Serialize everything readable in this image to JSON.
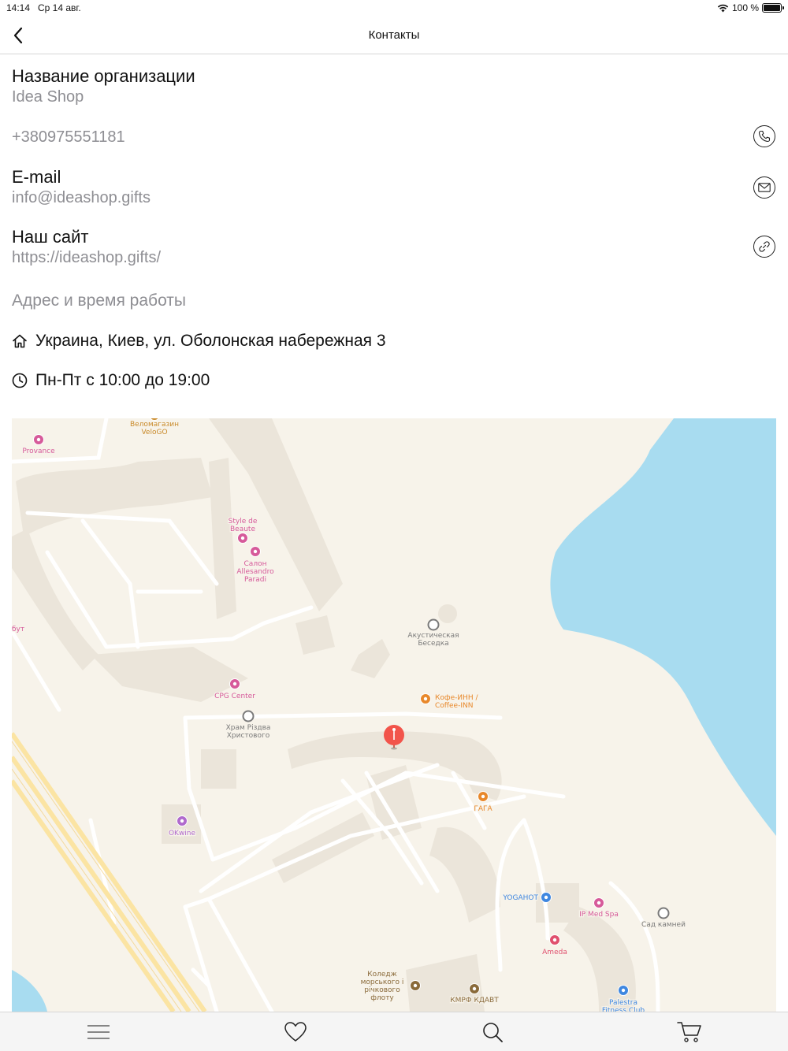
{
  "status_bar": {
    "time": "14:14",
    "date": "Ср 14 авг.",
    "battery": "100 %"
  },
  "nav": {
    "title": "Контакты"
  },
  "org": {
    "label": "Название организации",
    "value": "Idea Shop"
  },
  "phone": {
    "value": "+380975551181"
  },
  "email": {
    "label": "E-mail",
    "value": "info@ideashop.gifts"
  },
  "site": {
    "label": "Наш сайт",
    "value": "https://ideashop.gifts/"
  },
  "address_section": {
    "title": "Адрес и время работы",
    "address": "Украина, Киев, ул. Оболонская набережная 3",
    "hours": "Пн-Пт с 10:00 до 19:00"
  },
  "map": {
    "water_color": "#a8dcf0",
    "land_color": "#f7f3ea",
    "road_color": "#ffffff",
    "highway_color": "#fde9a8",
    "pin_color": "#f2544b",
    "pois": [
      {
        "name": "Веломагазин\nVeloGO",
        "color": "#c98a2a",
        "icon": "shop-icon"
      },
      {
        "name": "Provance",
        "color": "#d65a9a",
        "icon": "beauty-icon"
      },
      {
        "name": "Style de\nBeaute",
        "color": "#d65a9a",
        "icon": "beauty-icon"
      },
      {
        "name": "Салон\nAllesandro\nParadi",
        "color": "#d65a9a",
        "icon": "beauty-icon"
      },
      {
        "name": "бут",
        "color": "#d65a9a",
        "icon": ""
      },
      {
        "name": "Акустическая\nБеседка",
        "color": "#7a7a7a",
        "icon": "landmark-icon"
      },
      {
        "name": "CPG Center",
        "color": "#d65a9a",
        "icon": "beauty-icon"
      },
      {
        "name": "Кофе-ИНН /\nCoffee-INN",
        "color": "#e8882b",
        "icon": "cafe-icon"
      },
      {
        "name": "Храм Різдва\nХристового",
        "color": "#7a7a7a",
        "icon": "landmark-icon"
      },
      {
        "name": "ГАГА",
        "color": "#e8882b",
        "icon": "restaurant-icon"
      },
      {
        "name": "OKwine",
        "color": "#b06acd",
        "icon": "wine-icon"
      },
      {
        "name": "YOGAHOT",
        "color": "#3f87e0",
        "icon": "fitness-icon"
      },
      {
        "name": "IP Med Spa",
        "color": "#d65a9a",
        "icon": "beauty-icon"
      },
      {
        "name": "Сад камней",
        "color": "#7a7a7a",
        "icon": "landmark-icon"
      },
      {
        "name": "Ameda",
        "color": "#e0506e",
        "icon": "medical-icon"
      },
      {
        "name": "Коледж\nморського і\nрічкового\nфлоту",
        "color": "#8a6a3a",
        "icon": "school-icon"
      },
      {
        "name": "КМРФ КДАВТ",
        "color": "#8a6a3a",
        "icon": "school-icon"
      },
      {
        "name": "Palestra\nFitness Club",
        "color": "#3f87e0",
        "icon": "fitness-icon"
      }
    ]
  },
  "tabs": [
    {
      "name": "menu",
      "icon": "menu-icon"
    },
    {
      "name": "favorites",
      "icon": "heart-icon"
    },
    {
      "name": "search",
      "icon": "search-icon"
    },
    {
      "name": "cart",
      "icon": "cart-icon"
    }
  ]
}
